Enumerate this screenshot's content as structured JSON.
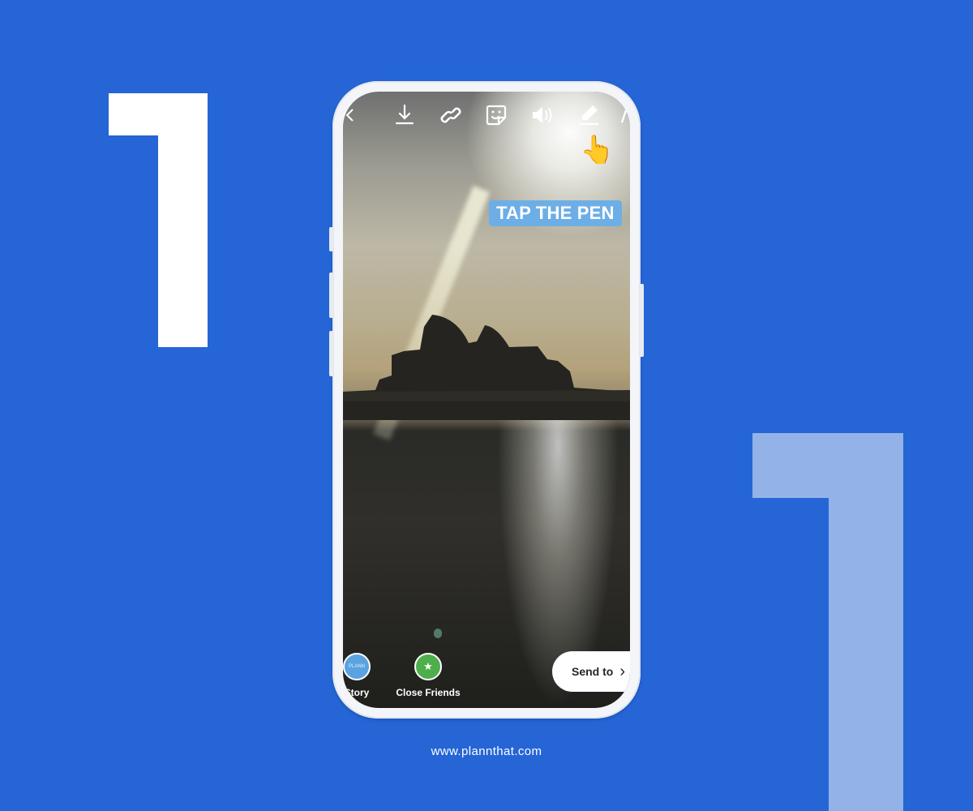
{
  "colors": {
    "background": "#2565d6",
    "numeral_left": "#ffffff",
    "numeral_right": "#93b2e8",
    "tap_label_bg": "#6eaee6",
    "close_friends_green": "#4fae4c",
    "story_blue": "#5aa3e0"
  },
  "decor": {
    "numeral_left": "1",
    "numeral_right": "1"
  },
  "story_editor": {
    "toolbar": [
      {
        "name": "download-icon",
        "label": "Download"
      },
      {
        "name": "link-icon",
        "label": "Link"
      },
      {
        "name": "sticker-icon",
        "label": "Sticker"
      },
      {
        "name": "sound-icon",
        "label": "Sound"
      },
      {
        "name": "pen-icon",
        "label": "Draw"
      },
      {
        "name": "text-icon",
        "label": "Text"
      }
    ],
    "pointer_emoji": "👆",
    "annotation": "TAP THE PEN",
    "share": {
      "story_label": "Story",
      "story_avatar_text": "PLANN",
      "close_friends_label": "Close Friends",
      "close_friends_icon": "★",
      "send_label": "Send to",
      "send_chevron": "›"
    }
  },
  "footer": {
    "url": "www.plannthat.com"
  }
}
